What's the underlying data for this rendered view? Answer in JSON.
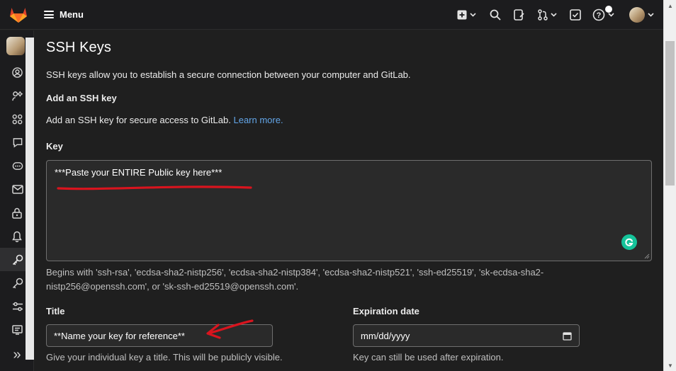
{
  "topbar": {
    "menu_label": "Menu",
    "icons": [
      "gitlab-logo",
      "plus-icon",
      "search-icon",
      "issues-icon",
      "merge-request-icon",
      "todo-icon",
      "help-icon",
      "user-avatar"
    ]
  },
  "sidebar": {
    "items": [
      "user-profile-icon",
      "applications-icon",
      "account-icon",
      "comments-icon",
      "chat-icon",
      "email-icon",
      "password-icon",
      "notifications-icon",
      "ssh-keys-icon",
      "gpg-keys-icon",
      "preferences-icon",
      "active-sessions-icon"
    ],
    "active_index": 8,
    "collapse_label": "»"
  },
  "page": {
    "title": "SSH Keys",
    "description": "SSH keys allow you to establish a secure connection between your computer and GitLab.",
    "add_heading": "Add an SSH key",
    "add_description": "Add an SSH key for secure access to GitLab.",
    "learn_more": "Learn more.",
    "key_label": "Key",
    "key_value": "***Paste your ENTIRE Public key here***",
    "key_help": "Begins with 'ssh-rsa', 'ecdsa-sha2-nistp256', 'ecdsa-sha2-nistp384', 'ecdsa-sha2-nistp521', 'ssh-ed25519', 'sk-ecdsa-sha2-nistp256@openssh.com', or 'sk-ssh-ed25519@openssh.com'.",
    "title_label": "Title",
    "title_value": "**Name your key for reference**",
    "title_help": "Give your individual key a title. This will be publicly visible.",
    "expiration_label": "Expiration date",
    "expiration_placeholder": "mm/dd/yyyy",
    "expiration_help": "Key can still be used after expiration."
  },
  "colors": {
    "accent_link": "#63a6e9",
    "annotation_red": "#d9141e",
    "grammarly_green": "#15c39a"
  }
}
